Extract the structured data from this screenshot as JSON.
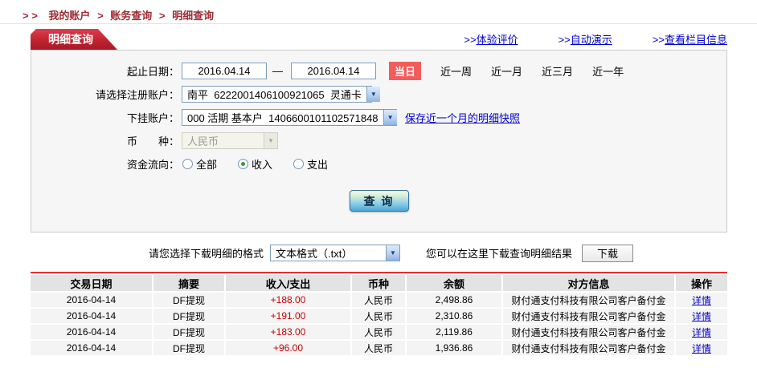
{
  "breadcrumb": {
    "prefix": "> >",
    "separator": ">",
    "items": [
      "我的账户",
      "账务查询",
      "明细查询"
    ]
  },
  "tabbar": {
    "tab": "明细查询",
    "links": [
      {
        "prefix": ">>",
        "label": "体验评价"
      },
      {
        "prefix": ">>",
        "label": "自动演示"
      },
      {
        "prefix": ">>",
        "label": "查看栏目信息"
      }
    ]
  },
  "form": {
    "date": {
      "label": "起止日期：",
      "start": "2016.04.14",
      "dash": "—",
      "end": "2016.04.14",
      "badge": "当日",
      "quick": [
        "近一周",
        "近一月",
        "近三月",
        "近一年"
      ]
    },
    "account": {
      "label": "请选择注册账户：",
      "value": "南平  6222001406100921065  灵通卡"
    },
    "sub_account": {
      "label": "下挂账户：",
      "value": "000 活期 基本户  1406600101102571848",
      "snapshot_link": "保存近一个月的明细快照"
    },
    "currency": {
      "label": "币　　种：",
      "value": "人民币"
    },
    "flow": {
      "label": "资金流向：",
      "options": [
        {
          "label": "全部",
          "selected": false
        },
        {
          "label": "收入",
          "selected": true
        },
        {
          "label": "支出",
          "selected": false
        }
      ]
    },
    "query_button": "查 询"
  },
  "download": {
    "format_label": "请您选择下载明细的格式",
    "format_value": "文本格式（.txt）",
    "hint": "您可以在这里下载查询明细结果",
    "button": "下载"
  },
  "table": {
    "headers": [
      "交易日期",
      "摘要",
      "收入/支出",
      "币种",
      "余额",
      "对方信息",
      "操作"
    ],
    "rows": [
      {
        "date": "2016-04-14",
        "summary": "DF提现",
        "amount": "+188.00",
        "currency": "人民币",
        "balance": "2,498.86",
        "counterparty": "财付通支付科技有限公司客户备付金",
        "action": "详情"
      },
      {
        "date": "2016-04-14",
        "summary": "DF提现",
        "amount": "+191.00",
        "currency": "人民币",
        "balance": "2,310.86",
        "counterparty": "财付通支付科技有限公司客户备付金",
        "action": "详情"
      },
      {
        "date": "2016-04-14",
        "summary": "DF提现",
        "amount": "+183.00",
        "currency": "人民币",
        "balance": "2,119.86",
        "counterparty": "财付通支付科技有限公司客户备付金",
        "action": "详情"
      },
      {
        "date": "2016-04-14",
        "summary": "DF提现",
        "amount": "+96.00",
        "currency": "人民币",
        "balance": "1,936.86",
        "counterparty": "财付通支付科技有限公司客户备付金",
        "action": "详情"
      }
    ]
  },
  "colors": {
    "accent_red": "#c02431",
    "link_blue": "#0000cc",
    "amount_red": "#cc0000",
    "badge_red": "#f25c5c",
    "panel_bg": "#f6f6f6"
  }
}
